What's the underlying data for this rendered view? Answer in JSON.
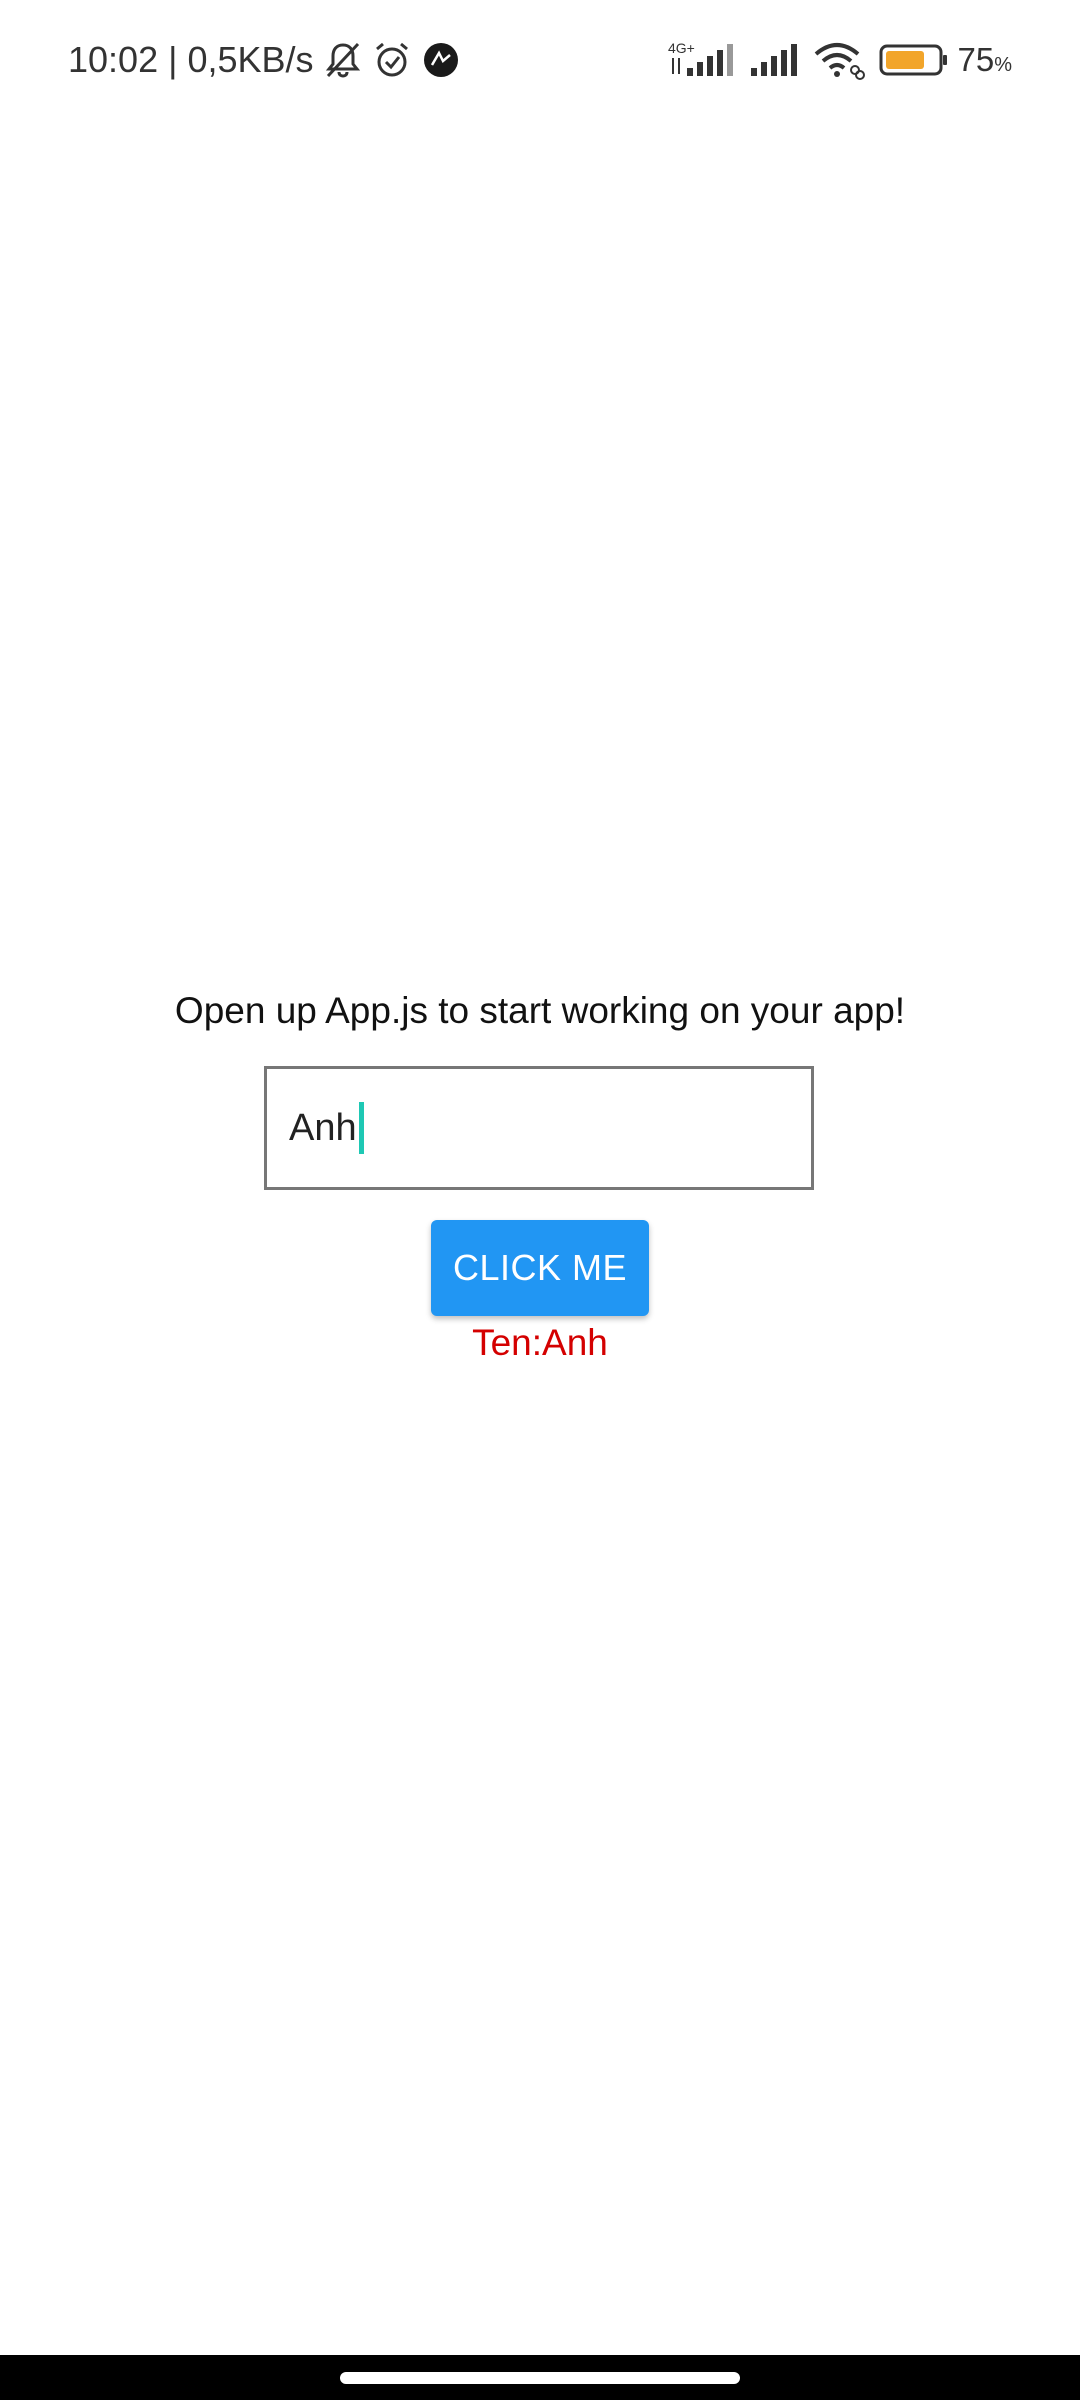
{
  "status_bar": {
    "time_speed": "10:02 | 0,5KB/s",
    "network_type": "4G+",
    "battery_percent": "75",
    "battery_unit": "%",
    "battery_level": 0.75,
    "battery_color": "#f2a52a",
    "icons": [
      "bell-off-icon",
      "alarm-icon",
      "app-notification-icon",
      "signal-4g-icon",
      "signal-icon",
      "wifi-icon",
      "battery-icon"
    ]
  },
  "main": {
    "hint_text": "Open up App.js to start working on your app!",
    "input_value": "Anh",
    "button_label": "CLICK ME",
    "result_text": "Ten:Anh"
  },
  "colors": {
    "button": "#2196f3",
    "result": "#d40000",
    "caret": "#1ec8b4"
  }
}
